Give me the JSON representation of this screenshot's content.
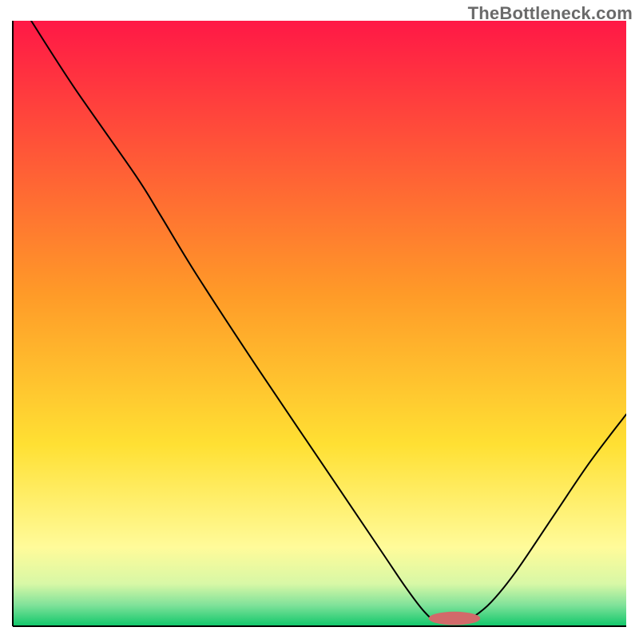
{
  "watermark": {
    "text": "TheBottleneck.com"
  },
  "chart_data": {
    "type": "line",
    "title": "",
    "xlabel": "",
    "ylabel": "",
    "xlim": [
      0,
      100
    ],
    "ylim": [
      0,
      100
    ],
    "grid": false,
    "legend": false,
    "background_gradient": {
      "stops": [
        {
          "offset": 0.0,
          "color": "#ff1846"
        },
        {
          "offset": 0.45,
          "color": "#ff9a28"
        },
        {
          "offset": 0.7,
          "color": "#ffe033"
        },
        {
          "offset": 0.87,
          "color": "#fffb9a"
        },
        {
          "offset": 0.93,
          "color": "#d8f8a6"
        },
        {
          "offset": 0.965,
          "color": "#80e29a"
        },
        {
          "offset": 1.0,
          "color": "#0fc76a"
        }
      ]
    },
    "marker": {
      "cx": 72,
      "cy": 1.3,
      "rx": 4.2,
      "ry": 1.1,
      "color": "#d26a6a"
    },
    "series": [
      {
        "name": "bottleneck-curve",
        "color": "#000000",
        "stroke_width": 2,
        "points": [
          {
            "x": 3.0,
            "y": 100.0
          },
          {
            "x": 10.0,
            "y": 89.0
          },
          {
            "x": 20.0,
            "y": 74.5
          },
          {
            "x": 24.0,
            "y": 68.0
          },
          {
            "x": 30.0,
            "y": 58.0
          },
          {
            "x": 40.0,
            "y": 42.5
          },
          {
            "x": 50.0,
            "y": 27.5
          },
          {
            "x": 60.0,
            "y": 12.5
          },
          {
            "x": 64.0,
            "y": 6.5
          },
          {
            "x": 67.0,
            "y": 2.5
          },
          {
            "x": 69.0,
            "y": 1.0
          },
          {
            "x": 73.0,
            "y": 0.8
          },
          {
            "x": 75.0,
            "y": 1.5
          },
          {
            "x": 78.0,
            "y": 4.0
          },
          {
            "x": 82.0,
            "y": 9.0
          },
          {
            "x": 88.0,
            "y": 18.0
          },
          {
            "x": 94.0,
            "y": 27.0
          },
          {
            "x": 100.0,
            "y": 35.0
          }
        ]
      }
    ]
  }
}
